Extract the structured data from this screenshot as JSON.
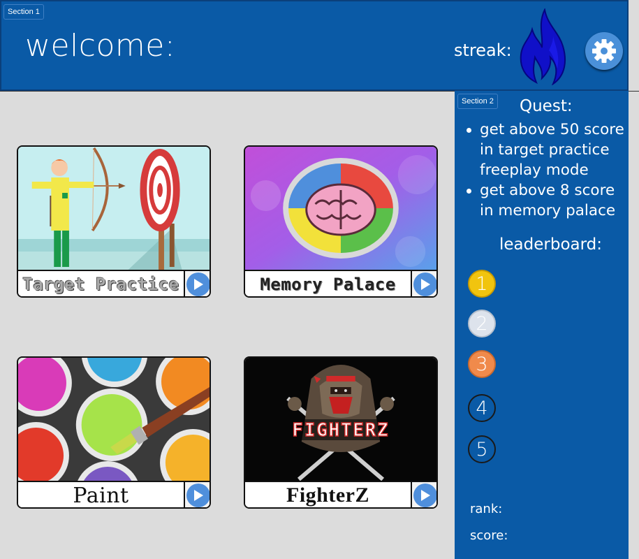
{
  "header": {
    "section_tag": "Section 1",
    "welcome": "welcome:",
    "streak_label": "streak:"
  },
  "sidebar": {
    "section_tag": "Section 2",
    "quest_title": "Quest:",
    "quests": [
      "get above 50 score in target practice freeplay mode",
      "get above 8 score in memory palace"
    ],
    "leaderboard_title": "leaderboard:",
    "leaderboard": [
      {
        "rank": "1",
        "color": "#f1c40f"
      },
      {
        "rank": "2",
        "color": "#dde3ec"
      },
      {
        "rank": "3",
        "color": "#f08a4b"
      },
      {
        "rank": "4",
        "color": "transparent"
      },
      {
        "rank": "5",
        "color": "transparent"
      }
    ],
    "rank_label": "rank:",
    "score_label": "score:"
  },
  "games": [
    {
      "title": "Target Practice",
      "icon": "archery-target-image"
    },
    {
      "title": "Memory Palace",
      "icon": "brain-image"
    },
    {
      "title": "Paint",
      "icon": "paint-cans-image"
    },
    {
      "title": "FighterZ",
      "icon": "ninja-fighter-image"
    }
  ],
  "colors": {
    "primary_blue": "#0a5aa6",
    "play_blue": "#4f8fdc",
    "background": "#dcdcdc"
  },
  "icons": {
    "streak": "flame-icon",
    "settings": "gear-icon",
    "play": "play-icon"
  }
}
